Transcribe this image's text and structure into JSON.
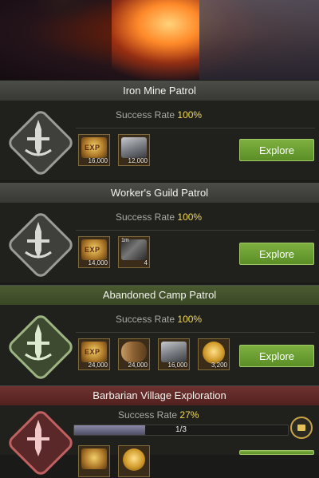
{
  "patrols": [
    {
      "title": "Iron Mine Patrol",
      "success_label": "Success Rate",
      "success_value": "100%",
      "emblem_color": "#9b9b96",
      "rewards": [
        {
          "icon": "exp-icon",
          "label": "EXP",
          "qty": "16,000"
        },
        {
          "icon": "iron-icon",
          "label": "",
          "qty": "12,000"
        }
      ],
      "button": "Explore"
    },
    {
      "title": "Worker's Guild Patrol",
      "success_label": "Success Rate",
      "success_value": "100%",
      "emblem_color": "#9b9b96",
      "rewards": [
        {
          "icon": "exp-icon",
          "label": "EXP",
          "qty": "14,000"
        },
        {
          "icon": "speedup-icon",
          "label": "1m",
          "qty": "4"
        }
      ],
      "button": "Explore"
    },
    {
      "title": "Abandoned Camp Patrol",
      "success_label": "Success Rate",
      "success_value": "100%",
      "emblem_color": "#9cb482",
      "rewards": [
        {
          "icon": "exp-icon",
          "label": "EXP",
          "qty": "24,000"
        },
        {
          "icon": "wood-icon",
          "label": "",
          "qty": "24,000"
        },
        {
          "icon": "iron-icon",
          "label": "",
          "qty": "16,000"
        },
        {
          "icon": "gold-icon",
          "label": "",
          "qty": "3,200"
        }
      ],
      "button": "Explore"
    },
    {
      "title": "Barbarian Village Exploration",
      "success_label": "Success Rate",
      "success_value": "27%",
      "emblem_color": "#c06060",
      "progress_text": "1/3",
      "progress_fraction": 0.333
    }
  ],
  "colors": {
    "accent_yellow": "#f1d95a",
    "explore_green": "#5a8e26"
  }
}
